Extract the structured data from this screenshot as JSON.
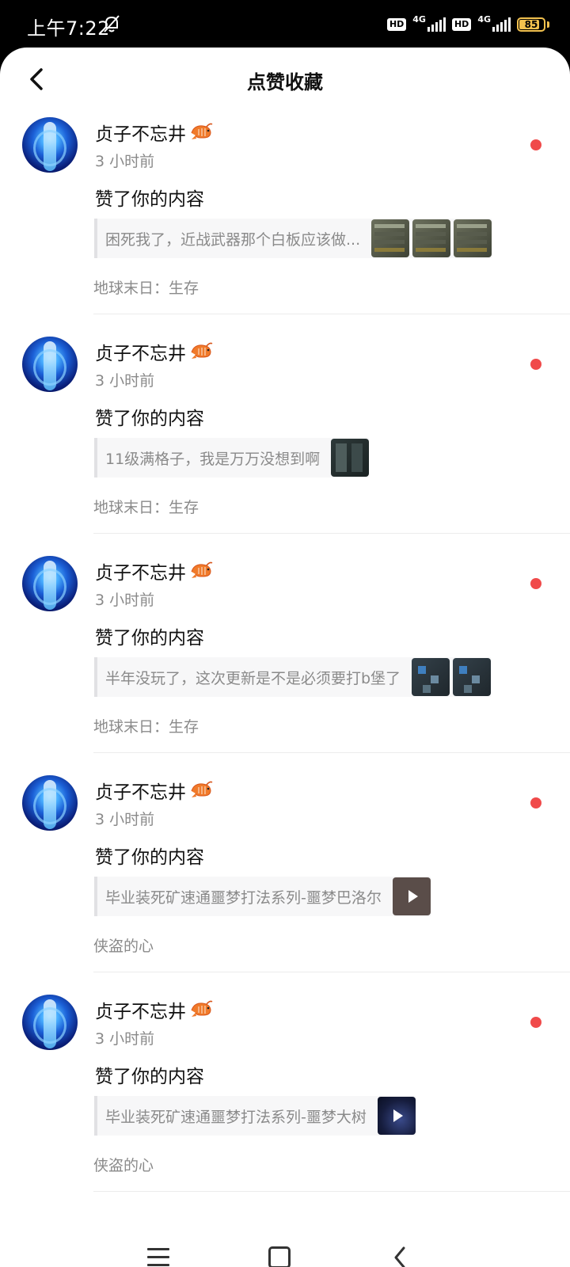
{
  "status_bar": {
    "time": "上午7:22",
    "hd_label": "HD",
    "network_label": "4G",
    "battery_level": "85",
    "battery_percent": 85
  },
  "header": {
    "title": "点赞收藏"
  },
  "notifications": [
    {
      "username": "贞子不忘井",
      "time": "3 小时前",
      "action": "赞了你的内容",
      "quote": "困死我了，近战武器那个白板应该做...",
      "thumbnails": [
        "image",
        "image",
        "image"
      ],
      "source": "地球末日：生存",
      "unread": true
    },
    {
      "username": "贞子不忘井",
      "time": "3 小时前",
      "action": "赞了你的内容",
      "quote": "11级满格子，我是万万没想到啊",
      "thumbnails": [
        "image"
      ],
      "source": "地球末日：生存",
      "unread": true
    },
    {
      "username": "贞子不忘井",
      "time": "3 小时前",
      "action": "赞了你的内容",
      "quote": "半年没玩了，这次更新是不是必须要打b堡了",
      "thumbnails": [
        "image",
        "image"
      ],
      "source": "地球末日：生存",
      "unread": true
    },
    {
      "username": "贞子不忘井",
      "time": "3 小时前",
      "action": "赞了你的内容",
      "quote": "毕业装死矿速通噩梦打法系列-噩梦巴洛尔",
      "thumbnails": [
        "video"
      ],
      "source": "侠盗的心",
      "unread": true
    },
    {
      "username": "贞子不忘井",
      "time": "3 小时前",
      "action": "赞了你的内容",
      "quote": "毕业装死矿速通噩梦打法系列-噩梦大树",
      "thumbnails": [
        "video"
      ],
      "source": "侠盗的心",
      "unread": true
    }
  ],
  "colors": {
    "unread_dot": "#f04a4a",
    "secondary_text": "#8a8a8a",
    "battery": "#f2c14e"
  },
  "nav_bar": {
    "icons": [
      "menu-icon",
      "home-square-icon",
      "back-arrow-icon"
    ]
  }
}
